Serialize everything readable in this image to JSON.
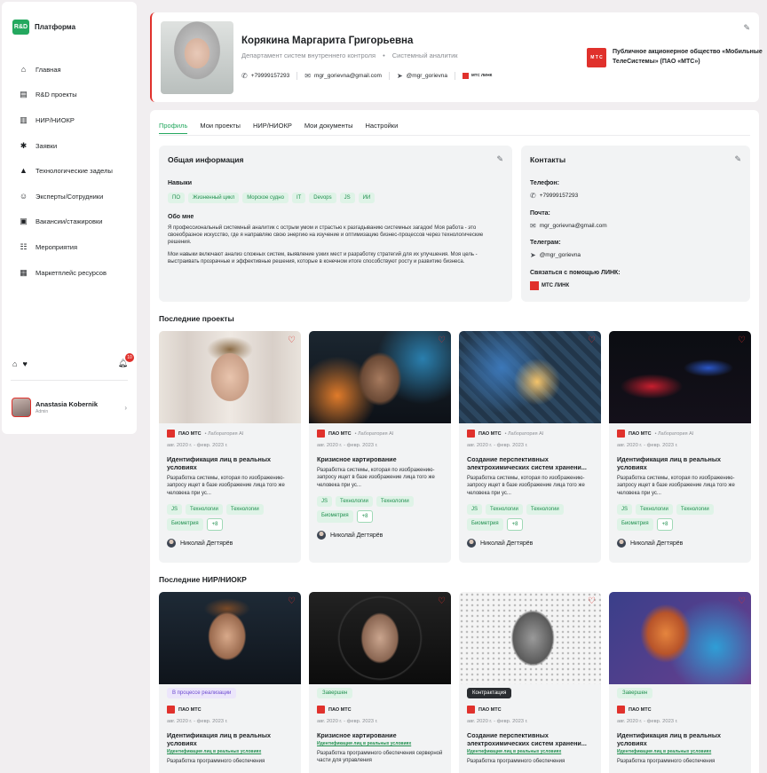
{
  "brand": {
    "logo": "R&D",
    "name": "Платформа"
  },
  "nav": [
    {
      "label": "Главная",
      "icon": "home-icon",
      "glyph": "⌂"
    },
    {
      "label": "R&D проекты",
      "icon": "projects-icon",
      "glyph": "▤"
    },
    {
      "label": "НИР/НИОКР",
      "icon": "book-icon",
      "glyph": "▥"
    },
    {
      "label": "Заявки",
      "icon": "requests-icon",
      "glyph": "✱"
    },
    {
      "label": "Технологические заделы",
      "icon": "flask-icon",
      "glyph": "▲"
    },
    {
      "label": "Эксперты/Сотрудники",
      "icon": "experts-icon",
      "glyph": "☺"
    },
    {
      "label": "Вакансии/стажировки",
      "icon": "briefcase-icon",
      "glyph": "▣"
    },
    {
      "label": "Мероприятия",
      "icon": "events-icon",
      "glyph": "☷"
    },
    {
      "label": "Маркетплейс ресурсов",
      "icon": "marketplace-icon",
      "glyph": "▦"
    }
  ],
  "notifications": {
    "count": "10"
  },
  "user": {
    "name": "Anastasia Kobernik",
    "role": "Admin"
  },
  "profile": {
    "name": "Корякина Маргарита Григорьевна",
    "department": "Департамент систем внутреннего контроля",
    "position": "Системный аналитик",
    "phone": "+79999157293",
    "email": "mgr_gorievna@gmail.com",
    "telegram": "@mgr_gorievna",
    "link_logo": "МТС ЛИНК",
    "company_logo": "М Т С",
    "company": "Публичное акционерное общество «Мобильные ТелеСистемы» (ПАО «МТС»)"
  },
  "tabs": [
    "Профиль",
    "Мои проекты",
    "НИР/НИОКР",
    "Мои документы",
    "Настройки"
  ],
  "general": {
    "title": "Общая информация",
    "skills_label": "Навыки",
    "skills": [
      "ПО",
      "Жизненный цикл",
      "Морское судно",
      "IT",
      "Devops",
      "JS",
      "ИИ"
    ],
    "about_label": "Обо мне",
    "about_1": "Я профессиональный системный аналитик с острым умом и страстью к разгадыванию системных загадок! Моя работа - это своеобразное искусство, где я направляю свою энергию на изучение и оптимизацию бизнес-процессов через технологические решения.",
    "about_2": "Мои навыки включают анализ сложных систем, выявление узких мест и разработку стратегий для их улучшения. Моя цель - выстраивать прозрачные и эффективные решения, которые в конечном итоге способствуют росту и развитию бизнеса."
  },
  "contacts": {
    "title": "Контакты",
    "phone_label": "Телефон:",
    "phone": "+79999157293",
    "email_label": "Почта:",
    "email": "mgr_gorievna@gmail.com",
    "telegram_label": "Телеграм:",
    "telegram": "@mgr_gorievna",
    "link_label": "Связаться с помощью ЛИНК:",
    "link_logo": "МТС ЛИНК"
  },
  "projects_title": "Последние проекты",
  "projects": [
    {
      "org": "ПАО МТС",
      "lab": "Лаборатория AI",
      "date": "авг. 2020 г. - февр. 2023 г.",
      "title": "Идентификация лиц в реальных условиях",
      "desc": "Разработка системы, которая по изображению-запросу ищет в базе изображение лица того же человека при ус...",
      "tags": [
        "JS",
        "Технологии",
        "Технологии",
        "Биометрия"
      ],
      "more": "+8",
      "author": "Николай Дегтярёв"
    },
    {
      "org": "ПАО МТС",
      "lab": "Лаборатория AI",
      "date": "авг. 2020 г. - февр. 2023 г.",
      "title": "Кризисное картирование",
      "desc": "Разработка системы, которая по изображению-запросу ищет в базе изображение лица того же человека при ус...",
      "tags": [
        "JS",
        "Технологии",
        "Технологии",
        "Биометрия"
      ],
      "more": "+8",
      "author": "Николай Дегтярёв"
    },
    {
      "org": "ПАО МТС",
      "lab": "Лаборатория AI",
      "date": "авг. 2020 г. - февр. 2023 г.",
      "title": "Создание перспективных электрохимических систем хранени...",
      "desc": "Разработка системы, которая по изображению-запросу ищет в базе изображение лица того же человека при ус...",
      "tags": [
        "JS",
        "Технологии",
        "Технологии",
        "Биометрия"
      ],
      "more": "+8",
      "author": "Николай Дегтярёв"
    },
    {
      "org": "ПАО МТС",
      "lab": "Лаборатория AI",
      "date": "авг. 2020 г. - февр. 2023 г.",
      "title": "Идентификация лиц в реальных условиях",
      "desc": "Разработка системы, которая по изображению-запросу ищет в базе изображение лица того же человека при ус...",
      "tags": [
        "JS",
        "Технологии",
        "Технологии",
        "Биометрия"
      ],
      "more": "+8",
      "author": "Николай Дегтярёв"
    }
  ],
  "nir_title": "Последние НИР/НИОКР",
  "nir": [
    {
      "status": "В процессе реализации",
      "org": "ПАО МТС",
      "date": "авг. 2020 г. - февр. 2023 г.",
      "title": "Идентификация лиц в реальных условиях",
      "link": "Идентификация лиц в реальных условиях",
      "desc": "Разработка программного обеспечения"
    },
    {
      "status": "Завершен",
      "org": "ПАО МТС",
      "date": "авг. 2020 г. - февр. 2023 г.",
      "title": "Кризисное картирование",
      "link": "Идентификация лиц в реальных условиях",
      "desc": "Разработка программного обеспечения серверной части для управления"
    },
    {
      "status": "Контрактация",
      "org": "ПАО МТС",
      "date": "авг. 2020 г. - февр. 2023 г.",
      "title": "Создание перспективных электрохимических систем хранени...",
      "link": "Идентификация лиц в реальных условиях",
      "desc": "Разработка программного обеспечения"
    },
    {
      "status": "Завершен",
      "org": "ПАО МТС",
      "date": "авг. 2020 г. - февр. 2023 г.",
      "title": "Идентификация лиц в реальных условиях",
      "link": "Идентификация лиц в реальных условиях",
      "desc": "Разработка программного обеспечения"
    }
  ],
  "colors": {
    "accent": "#24a85f",
    "brand_red": "#e0312c"
  }
}
